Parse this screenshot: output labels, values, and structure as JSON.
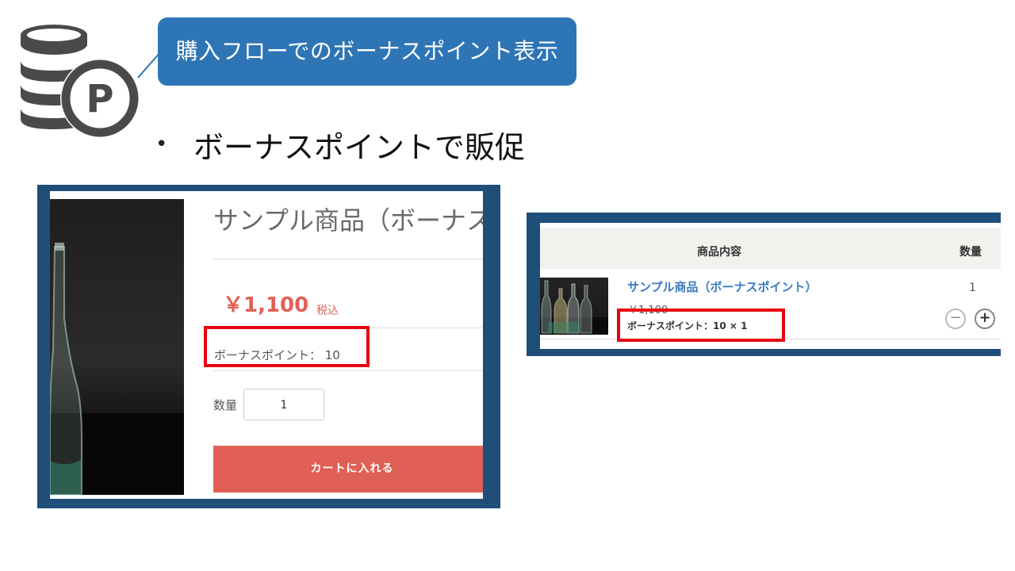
{
  "slide": {
    "callout_title": "購入フローでのボーナスポイント表示",
    "bullet_symbol": "•",
    "bullet_text": "ボーナスポイントで販促",
    "points_icon": "coin-stack-p-icon",
    "colors": {
      "callout": "#2e75b6",
      "panel_frame": "#1f4e79",
      "highlight": "#e60012",
      "price": "#e06055"
    }
  },
  "product_page": {
    "product_name": "サンプル商品（ボーナス",
    "price": "￥1,100",
    "tax_label": "税込",
    "bonus_points_label": "ボーナスポイント： 10",
    "quantity_label": "数量",
    "quantity_value": "1",
    "add_to_cart_label": "カートに入れる",
    "image": "glass-bottle-photo"
  },
  "cart": {
    "column_headers": [
      "商品内容",
      "数量"
    ],
    "item": {
      "name": "サンプル商品（ボーナスポイント）",
      "price": "￥1,100",
      "bonus_points": "ボーナスポイント：10 × 1",
      "quantity": "1",
      "image": "glass-bottles-thumbnail"
    },
    "minus_symbol": "−",
    "plus_symbol": "+"
  }
}
